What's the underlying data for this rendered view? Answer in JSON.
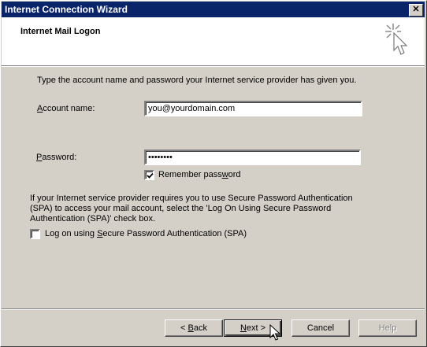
{
  "window": {
    "title": "Internet Connection Wizard",
    "close_glyph": "✕"
  },
  "header": {
    "title": "Internet Mail Logon",
    "icon": "wizard-sparkle-cursor-icon"
  },
  "form": {
    "intro": "Type the account name and password your Internet service provider has given you.",
    "account_label_mnemonic": "A",
    "account_label_rest": "ccount name:",
    "account_value": "you@yourdomain.com",
    "password_label_mnemonic": "P",
    "password_label_rest": "assword:",
    "password_value": "xxxxxxxx",
    "remember_label_pre": "Remember pass",
    "remember_label_mnemonic": "w",
    "remember_label_post": "ord",
    "remember_checked": true,
    "spa_info_line1": "If your Internet service provider requires you to use Secure Password Authentication",
    "spa_info_line2": "(SPA) to access your mail account, select the 'Log On Using Secure Password",
    "spa_info_line3": "Authentication (SPA)' check box.",
    "spa_label_pre": "Log on using ",
    "spa_label_mnemonic": "S",
    "spa_label_post": "ecure Password Authentication (SPA)",
    "spa_checked": false
  },
  "buttons": {
    "back_prefix": "< ",
    "back_mnemonic": "B",
    "back_rest": "ack",
    "next_mnemonic": "N",
    "next_rest": "ext",
    "next_suffix": " >",
    "cancel": "Cancel",
    "help": "Help"
  }
}
